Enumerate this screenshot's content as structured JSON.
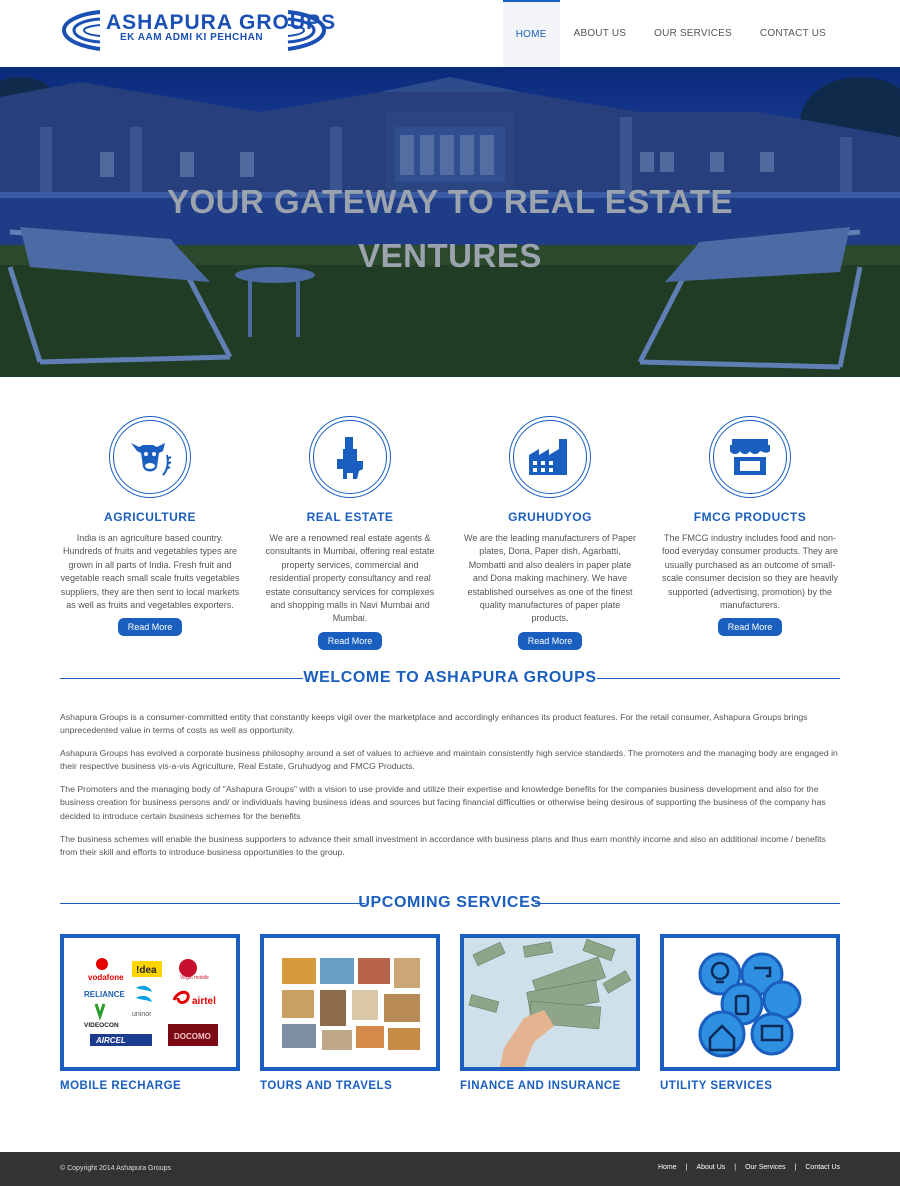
{
  "header": {
    "logo_title": "ASHAPURA GROUPS",
    "logo_tagline": "EK AAM ADMI KI PEHCHAN",
    "nav": [
      {
        "label": "HOME",
        "active": true
      },
      {
        "label": "ABOUT US",
        "active": false
      },
      {
        "label": "OUR SERVICES",
        "active": false
      },
      {
        "label": "CONTACT US",
        "active": false
      }
    ]
  },
  "hero": {
    "line1": "YOUR GATEWAY TO REAL ESTATE",
    "line2": "VENTURES"
  },
  "features": [
    {
      "icon": "cow-icon",
      "title": "AGRICULTURE",
      "text": "India is an agriculture based country. Hundreds of fruits and vegetables types are grown in all parts of India. Fresh fruit and vegetable reach small scale fruits vegetables suppliers, they are then sent to local markets as well as fruits and vegetables exporters.",
      "button": "Read More"
    },
    {
      "icon": "building-icon",
      "title": "REAL ESTATE",
      "text": "We are a renowned real estate agents & consultants in Mumbai, offering real estate property services, commercial and residential property consultancy and real estate consultancy services for complexes and shopping malls in Navi Mumbai and Mumbai.",
      "button": "Read More"
    },
    {
      "icon": "factory-icon",
      "title": "GRUHUDYOG",
      "text": "We are the leading manufacturers of Paper plates, Dona, Paper dish, Agarbatti, Mombatti and also dealers in paper plate and Dona making machinery. We have established ourselves as one of the finest quality manufactures of paper plate products.",
      "button": "Read More"
    },
    {
      "icon": "store-icon",
      "title": "FMCG PRODUCTS",
      "text": "The FMCG industry includes food and non-food everyday consumer products. They are usually purchased as an outcome of small-scale consumer decision so they are heavily supported (advertising, promotion) by the manufacturers.",
      "button": "Read More"
    }
  ],
  "welcome": {
    "title": "WELCOME TO ASHAPURA GROUPS",
    "paragraphs": [
      "Ashapura Groups is a consumer-committed entity that constantly keeps vigil over the marketplace and accordingly enhances its product features. For the retail consumer, Ashapura Groups brings unprecedented value in terms of costs as well as opportunity.",
      "Ashapura Groups has evolved a corporate business philosophy around a set of values to achieve and maintain consistently high service standards. The promoters and the managing body are engaged in their respective business vis-a-vis Agriculture, Real Estate, Gruhudyog and FMCG Products.",
      "The Promoters and the managing body of \"Ashapura Groups\" with a vision to use provide and utilize their expertise and knowledge benefits for the companies business development and also for the business creation for business persons and/ or individuals having business ideas and sources but facing financial difficulties or otherwise being desirous of supporting the business of the company has decided to introduce certain business schemes for the benefits",
      "The business schemes will enable the business supporters to advance their small investment in accordance with business plans and thus earn monthly income and also an additional income / benefits from their skill and efforts to introduce business opportunities to the group."
    ]
  },
  "services": {
    "title": "UPCOMING SERVICES",
    "items": [
      {
        "title": "MOBILE RECHARGE",
        "logos": [
          "vodafone",
          "!dea",
          "Virgin mobile",
          "RELIANCE",
          "uninor",
          "airtel",
          "VIDEOCON",
          "AIRCEL",
          "DOCOMO"
        ]
      },
      {
        "title": "TOURS AND TRAVELS"
      },
      {
        "title": "FINANCE AND INSURANCE"
      },
      {
        "title": "UTILITY SERVICES"
      }
    ]
  },
  "footer": {
    "copyright": "© Copyright 2014 Ashapura Groups",
    "links": [
      "Home",
      "About Us",
      "Our Services",
      "Contact Us"
    ]
  },
  "colors": {
    "brand": "#1a5fbf",
    "footer_bg": "#333333"
  }
}
